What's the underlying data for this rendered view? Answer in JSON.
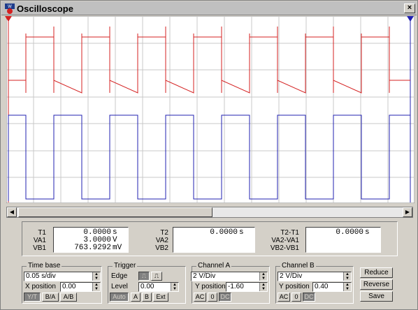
{
  "window": {
    "title": "Oscilloscope",
    "close_label": "×"
  },
  "colors": {
    "channel_a": "#d42020",
    "channel_b": "#2020b0",
    "grid": "#c8c8c8",
    "screen_bg": "#ffffff"
  },
  "cursors": {
    "t1_label": "1",
    "t2_label": "2"
  },
  "measurements": {
    "t1": {
      "labels": [
        "T1",
        "VA1",
        "VB1"
      ],
      "values": [
        "0.0000",
        "3.0000",
        "763.9292"
      ],
      "units": [
        "s",
        "V",
        "mV"
      ]
    },
    "t2": {
      "labels": [
        "T2",
        "VA2",
        "VB2"
      ],
      "values": [
        "0.0000",
        "",
        ""
      ],
      "units": [
        "s",
        "",
        ""
      ]
    },
    "diff": {
      "labels": [
        "T2-T1",
        "VA2-VA1",
        "VB2-VB1"
      ],
      "values": [
        "0.0000",
        "",
        ""
      ],
      "units": [
        "s",
        "",
        ""
      ]
    }
  },
  "timebase": {
    "title": "Time base",
    "value": "0.05 s/div",
    "xpos_label": "X position",
    "xpos_value": "0.00",
    "modes": [
      "Y/T",
      "B/A",
      "A/B"
    ]
  },
  "trigger": {
    "title": "Trigger",
    "edge_label": "Edge",
    "level_label": "Level",
    "level_value": "0.00",
    "sources": [
      "Auto",
      "A",
      "B",
      "Ext"
    ]
  },
  "channel_a": {
    "title": "Channel A",
    "scale": "2 V/Div",
    "ypos_label": "Y position",
    "ypos_value": "-1.60",
    "coupling": [
      "AC",
      "0",
      "DC"
    ]
  },
  "channel_b": {
    "title": "Channel B",
    "scale": "2 V/Div",
    "ypos_label": "Y position",
    "ypos_value": "0.40",
    "coupling": [
      "AC",
      "0",
      "DC"
    ]
  },
  "actions": {
    "reduce": "Reduce",
    "reverse": "Reverse",
    "save": "Save"
  },
  "icons": {
    "app": "oscilloscope-icon",
    "close": "close-icon",
    "scroll_left": "arrow-left-icon",
    "scroll_right": "arrow-right-icon"
  }
}
